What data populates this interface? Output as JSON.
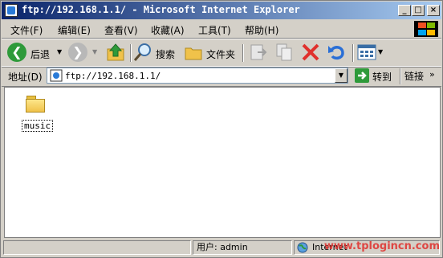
{
  "window": {
    "title": "ftp://192.168.1.1/ - Microsoft Internet Explorer",
    "controls": {
      "minimize": "_",
      "maximize": "□",
      "close": "×"
    }
  },
  "menu": [
    "文件(F)",
    "编辑(E)",
    "查看(V)",
    "收藏(A)",
    "工具(T)",
    "帮助(H)"
  ],
  "toolbar": {
    "back_label": "后退",
    "search_label": "搜索",
    "folders_label": "文件夹"
  },
  "address": {
    "label": "地址(D)",
    "value": "ftp://192.168.1.1/",
    "go_label": "转到",
    "links_label": "链接"
  },
  "folders": [
    {
      "name": "music"
    }
  ],
  "status": {
    "user": "用户: admin",
    "zone": "Internet"
  },
  "watermark": "www.tplogincn.com",
  "colors": {
    "titlebar": "#0a246a",
    "titlebar_end": "#a6caf0",
    "accent": "#e0302c"
  },
  "icons": [
    "ie-icon",
    "back-arrow-icon",
    "forward-arrow-icon",
    "up-folder-icon",
    "search-icon",
    "folder-icon",
    "move-to-icon",
    "copy-to-icon",
    "delete-icon",
    "undo-icon",
    "views-icon",
    "go-arrow-icon",
    "globe-icon"
  ]
}
